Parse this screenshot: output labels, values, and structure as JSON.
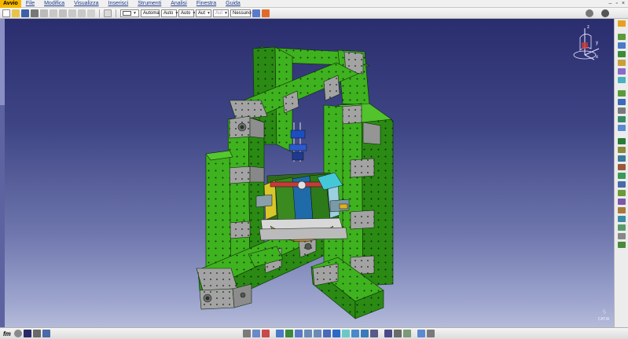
{
  "menu": {
    "app_label": "Avvio",
    "items": [
      "File",
      "Modifica",
      "Visualizza",
      "Inserisci",
      "Strumenti",
      "Analisi",
      "Finestra",
      "Guida"
    ],
    "window_controls": [
      "–",
      "▫",
      "×"
    ]
  },
  "toolbar": {
    "selects": [
      {
        "value": "Automa",
        "style": "mid"
      },
      {
        "value": "Auto",
        "style": "thin"
      },
      {
        "value": "Auto",
        "style": "thin"
      },
      {
        "value": "Aut",
        "style": "thin"
      },
      {
        "value": "Aut",
        "style": "thin disabled"
      },
      {
        "value": "Nessuno",
        "style": "wide"
      }
    ]
  },
  "bottom": {
    "command_label": "fm",
    "corner_logo": "CATIA"
  },
  "compass": {
    "axis_x": "x",
    "axis_y": "y",
    "axis_z": "z"
  },
  "colors": {
    "viewport_top": "#2a2d6e",
    "viewport_bottom": "#b5bbd9",
    "frame_green": "#3fb21f",
    "frame_green_dark": "#2a7d12",
    "frame_grey": "#9a9a9a",
    "app_accent": "#f5b800"
  },
  "icons": {
    "menu": [
      "new-file-icon",
      "open-icon",
      "save-icon",
      "print-icon",
      "cut-icon",
      "copy-icon",
      "paste-icon",
      "undo-icon",
      "redo-icon",
      "help-icon"
    ]
  }
}
